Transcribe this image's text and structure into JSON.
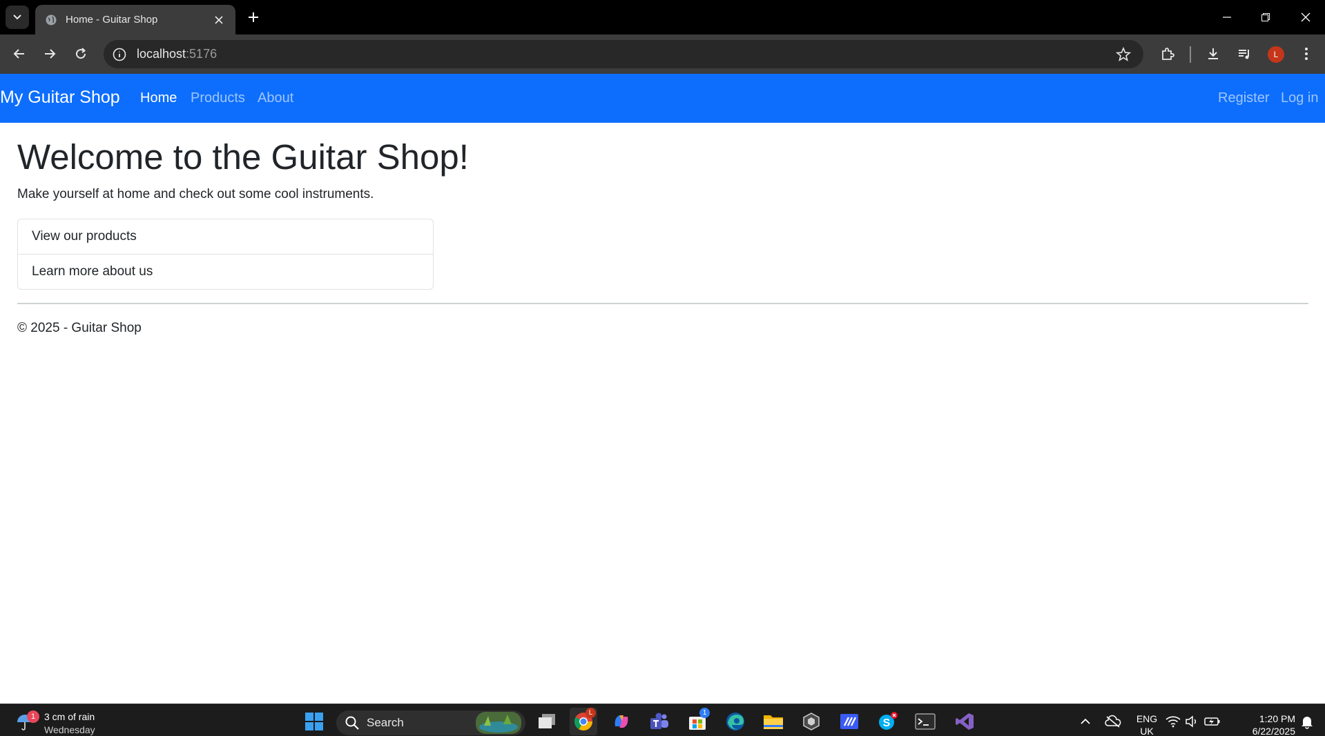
{
  "browser": {
    "tab_title": "Home - Guitar Shop",
    "url_host": "localhost",
    "url_port": ":5176",
    "profile_initial": "L"
  },
  "site": {
    "brand": "My Guitar Shop",
    "nav": {
      "home": "Home",
      "products": "Products",
      "about": "About",
      "register": "Register",
      "login": "Log in"
    },
    "hero": {
      "title": "Welcome to the Guitar Shop!",
      "subtitle": "Make yourself at home and check out some cool instruments."
    },
    "links": [
      "View our products",
      "Learn more about us"
    ],
    "footer": "© 2025 - Guitar Shop",
    "colors": {
      "navbar": "#0d6efd",
      "text": "#212529"
    }
  },
  "taskbar": {
    "weather_badge": "1",
    "weather_line1": "3 cm of rain",
    "weather_line2": "Wednesday",
    "search_label": "Search",
    "chrome_badge": "L",
    "store_badge": "1",
    "lang_line1": "ENG",
    "lang_line2": "UK",
    "time": "1:20 PM",
    "date": "6/22/2025"
  }
}
